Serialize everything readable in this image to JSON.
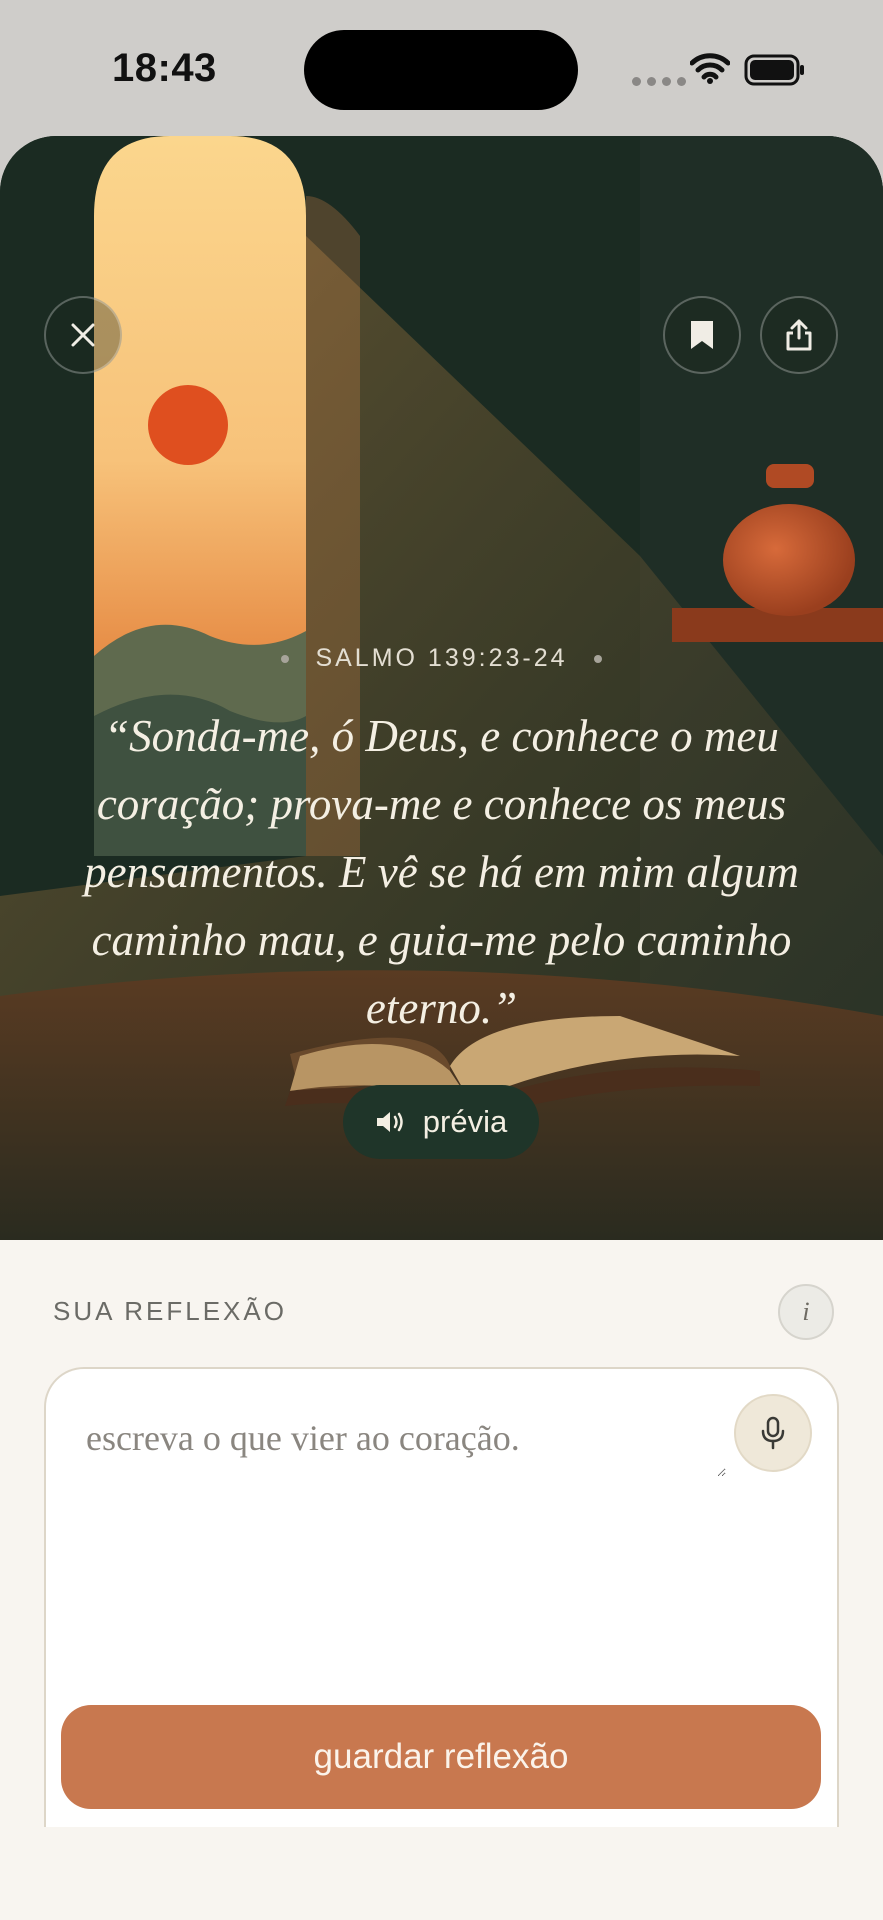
{
  "status_bar": {
    "time": "18:43"
  },
  "hero": {
    "close_icon": "close-icon",
    "bookmark_icon": "bookmark-icon",
    "share_icon": "share-icon",
    "reference": "SALMO 139:23-24",
    "verse": "“Sonda-me, ó Deus, e conhece o meu coração; prova-me e conhece os meus pensamentos. E vê se há em mim algum caminho mau, e guia-me pelo caminho eterno.”",
    "preview_label": "prévia",
    "preview_icon": "speaker-icon"
  },
  "reflection": {
    "title": "SUA REFLEXÃO",
    "info_label": "i",
    "placeholder": "escreva o que vier ao coração.",
    "mic_icon": "microphone-icon",
    "save_label": "guardar reflexão"
  },
  "colors": {
    "accent": "#c8784f",
    "hero_bg": "#1b2b22",
    "sheet_bg": "#f8f5f0"
  }
}
